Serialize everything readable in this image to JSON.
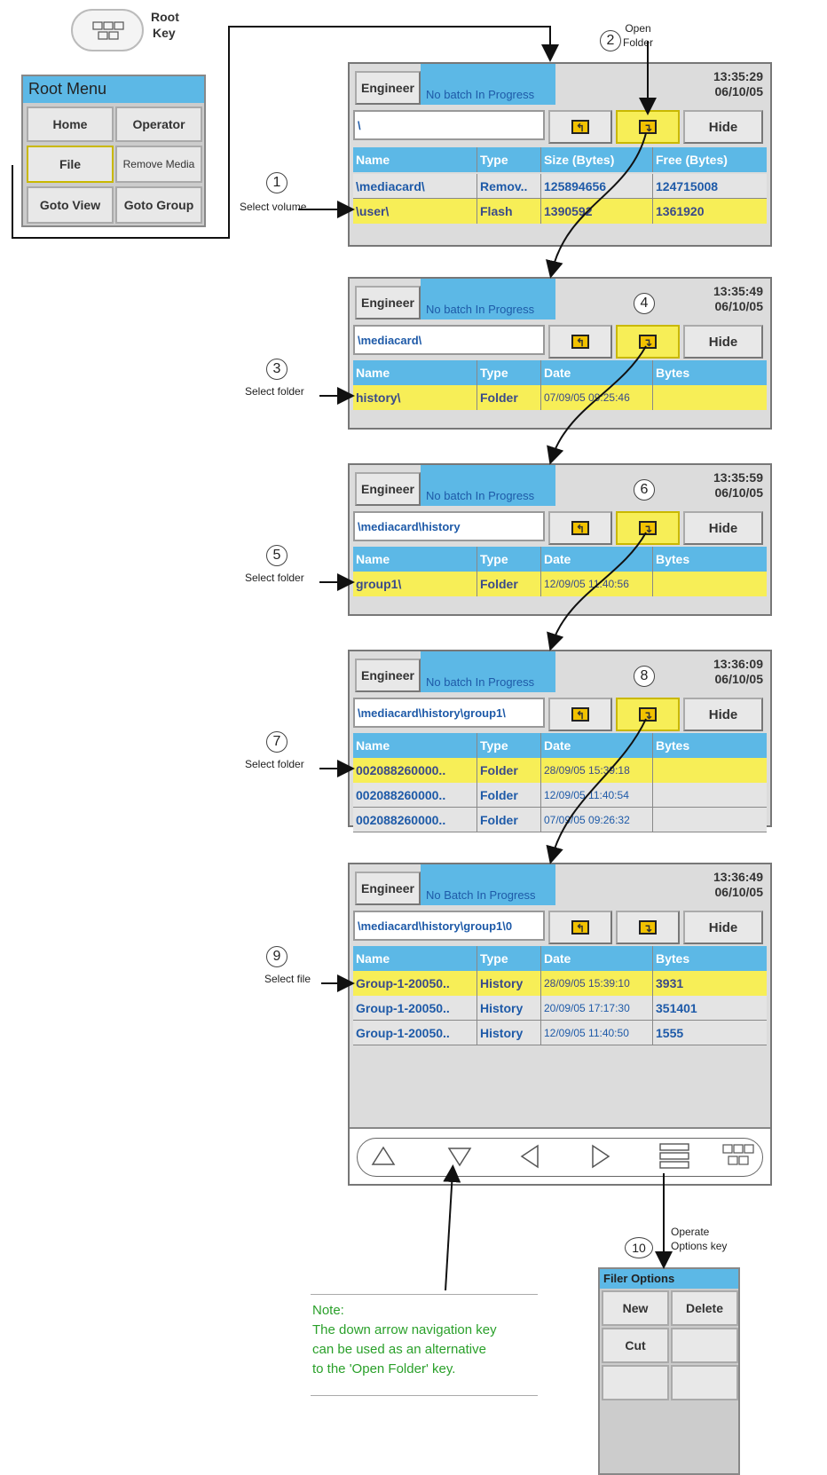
{
  "root_key": {
    "label_1": "Root",
    "label_2": "Key"
  },
  "root_menu": {
    "title": "Root Menu",
    "buttons": [
      "Home",
      "Operator",
      "File",
      "Remove Media",
      "Goto View",
      "Goto Group"
    ]
  },
  "steps": {
    "s1": "1",
    "s1_label": "Select volume",
    "s2": "2",
    "s2_label_1": "Open",
    "s2_label_2": "Folder",
    "s3": "3",
    "s3_label": "Select folder",
    "s4": "4",
    "s5": "5",
    "s5_label": "Select folder",
    "s6": "6",
    "s7": "7",
    "s7_label": "Select folder",
    "s8": "8",
    "s9": "9",
    "s9_label": "Select file",
    "s10": "10",
    "s10_label_1": "Operate",
    "s10_label_2": "Options key"
  },
  "screens": [
    {
      "user": "Engineer",
      "batch": "No batch In Progress",
      "time": "13:35:29",
      "date": "06/10/05",
      "path": "\\",
      "hide": "Hide",
      "headers": [
        "Name",
        "Type",
        "Size (Bytes)",
        "Free (Bytes)"
      ],
      "rows": [
        [
          "\\mediacard\\",
          "Remov..",
          "125894656",
          "124715008"
        ],
        [
          "\\user\\",
          "Flash",
          "1390592",
          "1361920"
        ]
      ]
    },
    {
      "user": "Engineer",
      "batch": "No batch In Progress",
      "time": "13:35:49",
      "date": "06/10/05",
      "path": "\\mediacard\\",
      "hide": "Hide",
      "headers": [
        "Name",
        "Type",
        "Date",
        "Bytes"
      ],
      "rows": [
        [
          "history\\",
          "Folder",
          "07/09/05 09:25:46",
          ""
        ]
      ]
    },
    {
      "user": "Engineer",
      "batch": "No batch In Progress",
      "time": "13:35:59",
      "date": "06/10/05",
      "path": "\\mediacard\\history",
      "hide": "Hide",
      "headers": [
        "Name",
        "Type",
        "Date",
        "Bytes"
      ],
      "rows": [
        [
          "group1\\",
          "Folder",
          "12/09/05 11:40:56",
          ""
        ]
      ]
    },
    {
      "user": "Engineer",
      "batch": "No batch In Progress",
      "time": "13:36:09",
      "date": "06/10/05",
      "path": "\\mediacard\\history\\group1\\",
      "hide": "Hide",
      "headers": [
        "Name",
        "Type",
        "Date",
        "Bytes"
      ],
      "rows": [
        [
          "002088260000..",
          "Folder",
          "28/09/05 15:39:18",
          ""
        ],
        [
          "002088260000..",
          "Folder",
          "12/09/05 11:40:54",
          ""
        ],
        [
          "002088260000..",
          "Folder",
          "07/09/05 09:26:32",
          ""
        ]
      ]
    },
    {
      "user": "Engineer",
      "batch": "No Batch In Progress",
      "time": "13:36:49",
      "date": "06/10/05",
      "path": "\\mediacard\\history\\group1\\0",
      "hide": "Hide",
      "headers": [
        "Name",
        "Type",
        "Date",
        "Bytes"
      ],
      "rows": [
        [
          "Group-1-20050..",
          "History",
          "28/09/05 15:39:10",
          "3931"
        ],
        [
          "Group-1-20050..",
          "History",
          "20/09/05 17:17:30",
          "351401"
        ],
        [
          "Group-1-20050..",
          "History",
          "12/09/05 11:40:50",
          "1555"
        ]
      ]
    }
  ],
  "filer_options": {
    "title": "Filer Options",
    "buttons": [
      "New",
      "Delete",
      "Cut",
      "",
      "",
      ""
    ]
  },
  "note": {
    "title": "Note:",
    "line_1": "The down arrow navigation key",
    "line_2": "can be used as an alternative",
    "line_3": "to the 'Open Folder' key."
  }
}
